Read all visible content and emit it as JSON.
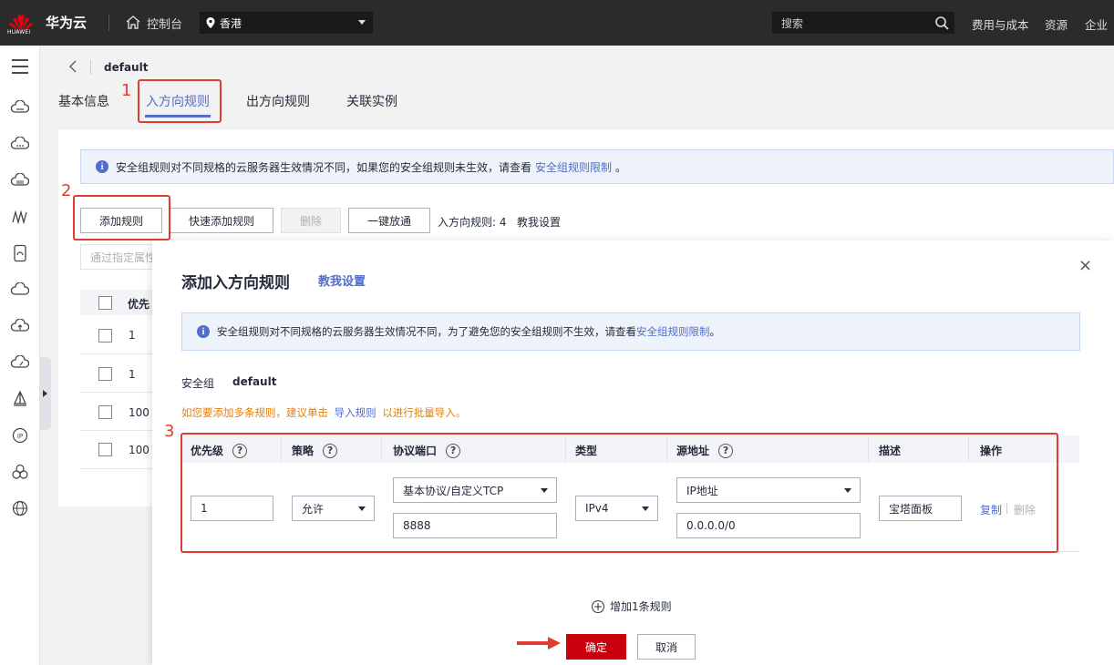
{
  "topbar": {
    "logo_text": "HUAWEI",
    "brand": "华为云",
    "console": "控制台",
    "region": "香港",
    "search_placeholder": "搜索",
    "links": [
      "费用与成本",
      "资源",
      "企业"
    ]
  },
  "header": {
    "sg_name": "default",
    "tabs": [
      {
        "label": "基本信息"
      },
      {
        "label": "入方向规则"
      },
      {
        "label": "出方向规则"
      },
      {
        "label": "关联实例"
      }
    ]
  },
  "annotations": {
    "n1": "1",
    "n2": "2",
    "n3": "3"
  },
  "background": {
    "alert_text": "安全组规则对不同规格的云服务器生效情况不同，如果您的安全组规则未生效，请查看",
    "alert_link": "安全组规则限制",
    "alert_tail": "。",
    "buttons": {
      "add": "添加规则",
      "quick_add": "快速添加规则",
      "delete": "删除",
      "one_click": "一键放通"
    },
    "rule_count": "入方向规则: 4",
    "help_link": "教我设置",
    "filter_placeholder": "通过指定属性",
    "table_header": "优先",
    "rows": [
      {
        "priority": "1"
      },
      {
        "priority": "1"
      },
      {
        "priority": "100"
      },
      {
        "priority": "100"
      }
    ]
  },
  "modal": {
    "title": "添加入方向规则",
    "help_link": "教我设置",
    "close": "×",
    "alert_text": "安全组规则对不同规格的云服务器生效情况不同，为了避免您的安全组规则不生效，请查看",
    "alert_link": "安全组规则限制",
    "alert_tail": "。",
    "sg_label": "安全组",
    "sg_value": "default",
    "warn_prefix": "如您要添加多条规则，建议单击",
    "warn_link": "导入规则",
    "warn_suffix": "以进行批量导入。",
    "columns": [
      "优先级",
      "策略",
      "协议端口",
      "类型",
      "源地址",
      "描述",
      "操作"
    ],
    "qmark": "?",
    "row": {
      "priority": "1",
      "policy": "允许",
      "protocol": "基本协议/自定义TCP",
      "port": "8888",
      "type": "IPv4",
      "source_type": "IP地址",
      "source": "0.0.0.0/0",
      "description": "宝塔面板",
      "copy": "复制",
      "delete": "删除"
    },
    "add_row": "增加1条规则",
    "confirm": "确定",
    "cancel": "取消"
  },
  "colors": {
    "accent": "#526ecc",
    "brand_red": "#c7000b",
    "annotation_red": "#e23b31",
    "warn": "#e87e04"
  }
}
